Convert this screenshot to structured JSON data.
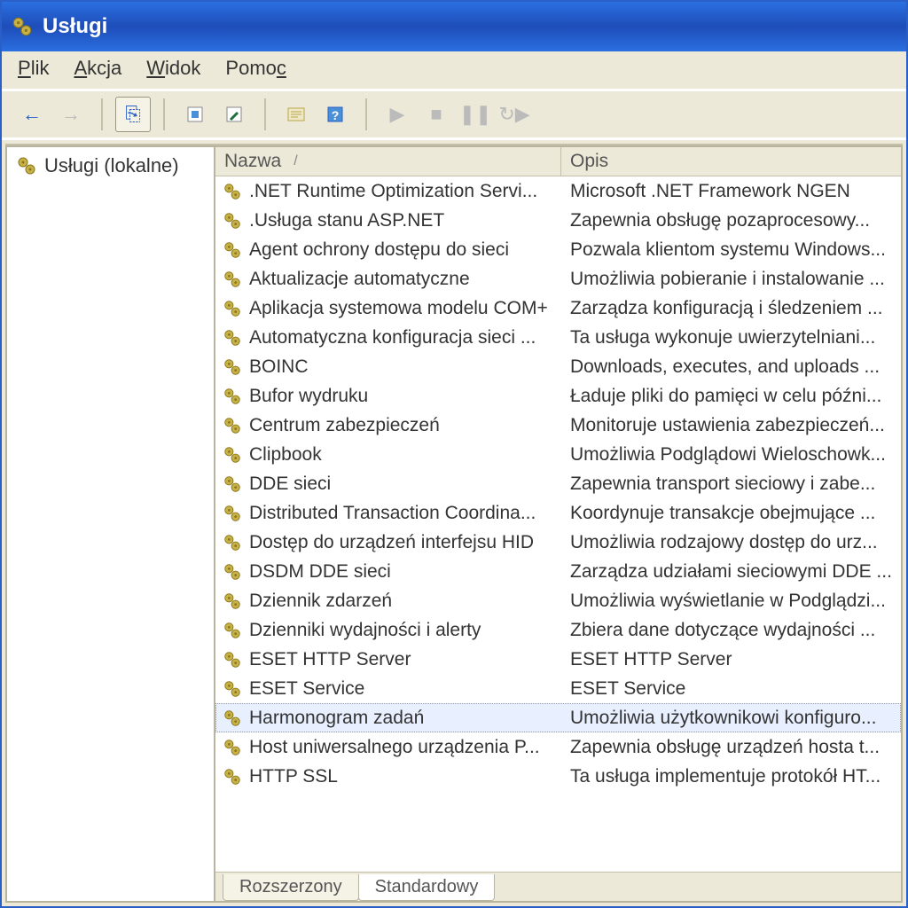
{
  "title": "Usługi",
  "menu": {
    "file": "Plik",
    "action": "Akcja",
    "view": "Widok",
    "help": "Pomoc"
  },
  "toolbar": {
    "back": "←",
    "forward": "→",
    "up": "⎘",
    "refresh": "↻",
    "export": "▣",
    "properties": "⚙",
    "help": "?",
    "play": "▶",
    "stop": "■",
    "pause": "❚❚",
    "restart": "↻▶"
  },
  "tree": {
    "root": "Usługi (lokalne)"
  },
  "columns": {
    "name": "Nazwa",
    "sort": "/",
    "desc": "Opis"
  },
  "tabs": {
    "ext": "Rozszerzony",
    "std": "Standardowy"
  },
  "services": [
    {
      "name": ".NET Runtime Optimization Servi...",
      "desc": "Microsoft .NET Framework NGEN"
    },
    {
      "name": ".Usługa stanu ASP.NET",
      "desc": "Zapewnia obsługę pozaprocesowy..."
    },
    {
      "name": "Agent ochrony dostępu do sieci",
      "desc": "Pozwala klientom systemu Windows..."
    },
    {
      "name": "Aktualizacje automatyczne",
      "desc": "Umożliwia pobieranie i instalowanie ..."
    },
    {
      "name": "Aplikacja systemowa modelu COM+",
      "desc": "Zarządza konfiguracją i śledzeniem ..."
    },
    {
      "name": "Automatyczna konfiguracja sieci ...",
      "desc": "Ta usługa wykonuje uwierzytelniani..."
    },
    {
      "name": "BOINC",
      "desc": "Downloads, executes, and uploads ..."
    },
    {
      "name": "Bufor wydruku",
      "desc": "Ładuje pliki do pamięci w celu późni..."
    },
    {
      "name": "Centrum zabezpieczeń",
      "desc": "Monitoruje ustawienia zabezpieczeń..."
    },
    {
      "name": "Clipbook",
      "desc": "Umożliwia Podglądowi Wieloschowk..."
    },
    {
      "name": "DDE sieci",
      "desc": "Zapewnia transport sieciowy i zabe..."
    },
    {
      "name": "Distributed Transaction Coordina...",
      "desc": "Koordynuje transakcje obejmujące ..."
    },
    {
      "name": "Dostęp do urządzeń interfejsu HID",
      "desc": "Umożliwia rodzajowy dostęp do urz..."
    },
    {
      "name": "DSDM DDE sieci",
      "desc": "Zarządza udziałami sieciowymi DDE ..."
    },
    {
      "name": "Dziennik zdarzeń",
      "desc": "Umożliwia wyświetlanie w Podglądzi..."
    },
    {
      "name": "Dzienniki wydajności i alerty",
      "desc": "Zbiera dane dotyczące wydajności ..."
    },
    {
      "name": "ESET HTTP Server",
      "desc": "ESET HTTP Server"
    },
    {
      "name": "ESET Service",
      "desc": "ESET Service"
    },
    {
      "name": "Harmonogram zadań",
      "desc": "Umożliwia użytkownikowi konfiguro...",
      "selected": true
    },
    {
      "name": "Host uniwersalnego urządzenia P...",
      "desc": "Zapewnia obsługę urządzeń hosta t..."
    },
    {
      "name": "HTTP SSL",
      "desc": "Ta usługa implementuje protokół HT..."
    }
  ]
}
